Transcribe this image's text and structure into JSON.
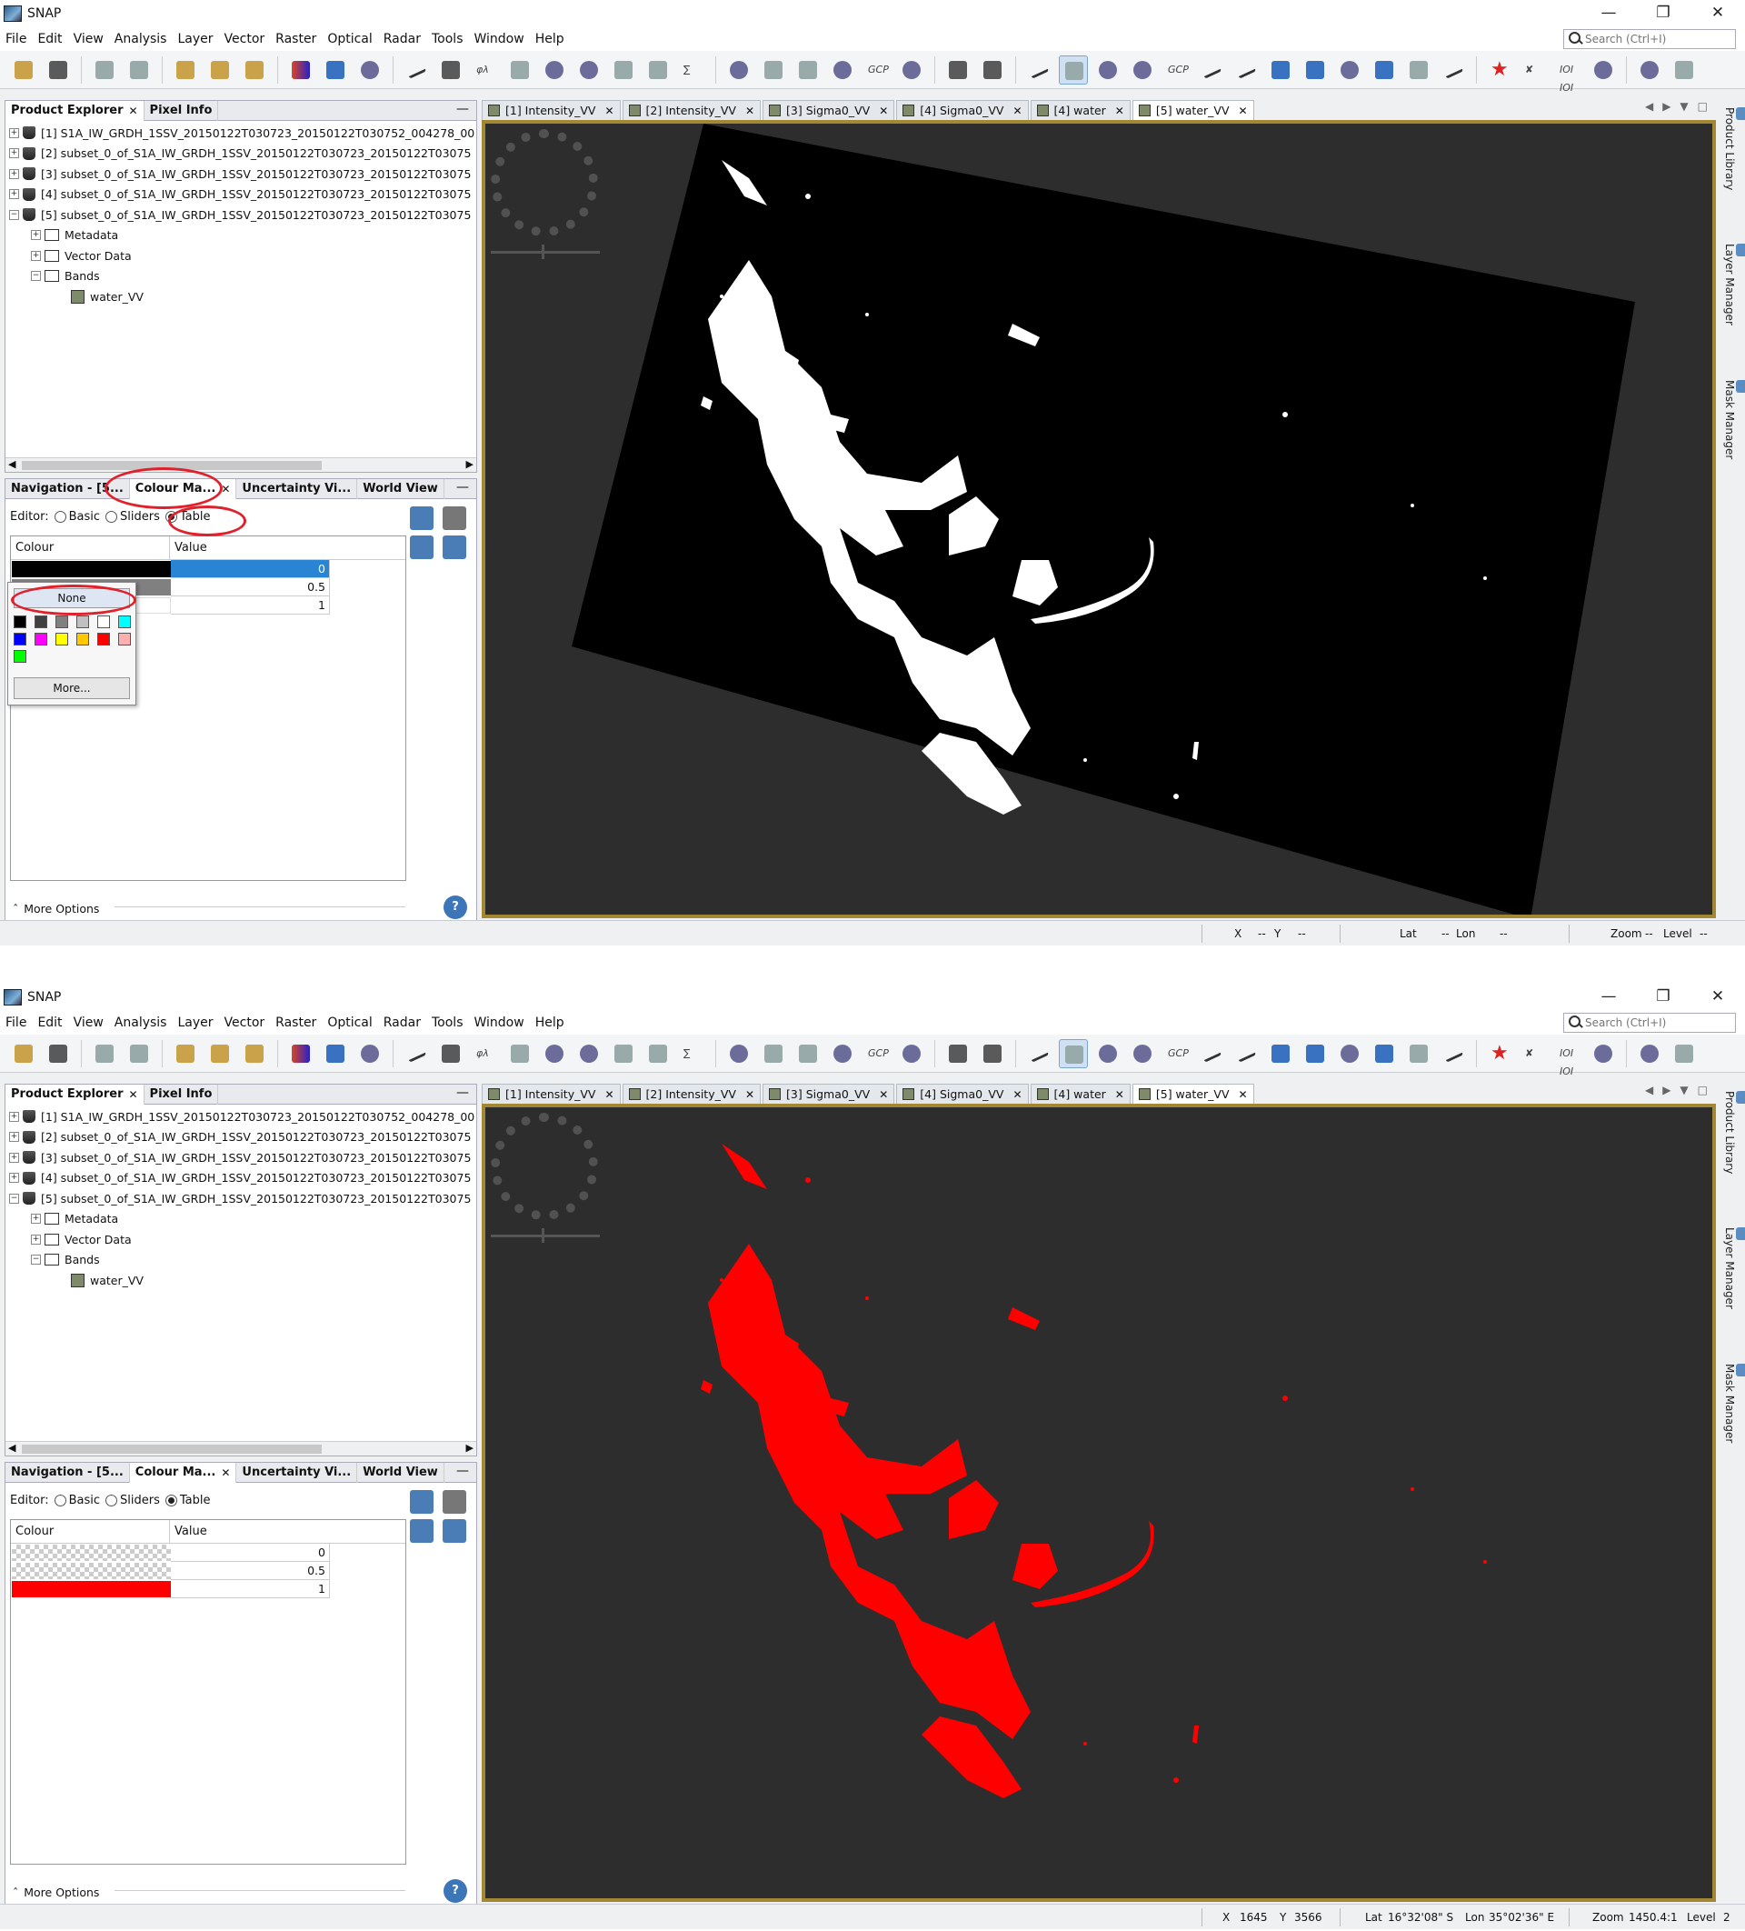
{
  "app": {
    "title": "SNAP",
    "window_controls": [
      "minimize-icon",
      "restore-icon",
      "close-icon"
    ]
  },
  "menu": [
    "File",
    "Edit",
    "View",
    "Analysis",
    "Layer",
    "Vector",
    "Raster",
    "Optical",
    "Radar",
    "Tools",
    "Window",
    "Help"
  ],
  "search": {
    "placeholder": "Search (Ctrl+I)"
  },
  "toolbar": {
    "gcp_label": "GCP",
    "gcp_label2": "GCP",
    "binary_label": "IOI IOI"
  },
  "explorer": {
    "tab1": "Product Explorer",
    "tab2": "Pixel Info",
    "products": [
      "[1] S1A_IW_GRDH_1SSV_20150122T030723_20150122T030752_004278_00",
      "[2] subset_0_of_S1A_IW_GRDH_1SSV_20150122T030723_20150122T03075",
      "[3] subset_0_of_S1A_IW_GRDH_1SSV_20150122T030723_20150122T03075",
      "[4] subset_0_of_S1A_IW_GRDH_1SSV_20150122T030723_20150122T03075",
      "[5] subset_0_of_S1A_IW_GRDH_1SSV_20150122T030723_20150122T03075"
    ],
    "children": [
      "Metadata",
      "Vector Data",
      "Bands"
    ],
    "band": "water_VV"
  },
  "colour_panel": {
    "tabs": [
      "Navigation - [5...",
      "Colour Ma...",
      "Uncertainty Vi...",
      "World View"
    ],
    "editor_label": "Editor:",
    "modes": [
      "Basic",
      "Sliders",
      "Table"
    ],
    "selected_mode": "Table",
    "col_colour": "Colour",
    "col_value": "Value",
    "more_options": "More Options"
  },
  "shot1": {
    "rows": [
      {
        "value": "0",
        "colour": "#000000",
        "selected": true
      },
      {
        "value": "0.5",
        "colour": "#808080"
      },
      {
        "value": "1",
        "colour": "#ffffff"
      }
    ],
    "popup": {
      "none_label": "None",
      "more_label": "More...",
      "swatches": [
        "#000000",
        "#404040",
        "#808080",
        "#c0c0c0",
        "#ffffff",
        "#00ffff",
        "#0000ff",
        "#ff00ff",
        "#ffff00",
        "#ffc800",
        "#ff0000",
        "#ffafaf",
        "#00ff00"
      ]
    },
    "status": {
      "x_label": "X",
      "x_value": "--",
      "y_label": "Y",
      "y_value": "--",
      "lat_label": "Lat",
      "lat_value": "--",
      "lon_label": "Lon",
      "lon_value": "--",
      "zoom_label": "Zoom",
      "zoom_value": "--",
      "level_label": "Level",
      "level_value": "--"
    }
  },
  "shot2": {
    "rows": [
      {
        "value": "0",
        "colour": "transparent"
      },
      {
        "value": "0.5",
        "colour": "transparent"
      },
      {
        "value": "1",
        "colour": "#ff0000"
      }
    ],
    "status": {
      "x_label": "X",
      "x_value": "1645",
      "y_label": "Y",
      "y_value": "3566",
      "lat_label": "Lat",
      "lat_value": "16°32'08\" S",
      "lon_label": "Lon",
      "lon_value": "35°02'36\" E",
      "zoom_label": "Zoom",
      "zoom_value": "1450.4:1",
      "level_label": "Level",
      "level_value": "2"
    }
  },
  "doc_tabs": [
    "[1] Intensity_VV",
    "[2] Intensity_VV",
    "[3] Sigma0_VV",
    "[4] Sigma0_VV",
    "[4] water",
    "[5] water_VV"
  ],
  "active_doc_tab": "[5] water_VV",
  "right_sidebar": [
    "Product Library",
    "Layer Manager",
    "Mask Manager"
  ],
  "colors": {
    "water_bright": "#ffffff",
    "water_red": "#ff0000",
    "view_background": "#2d2d2d",
    "scene_background": "#000000",
    "highlight_ring": "#e0212c",
    "view_border": "#a48732"
  }
}
